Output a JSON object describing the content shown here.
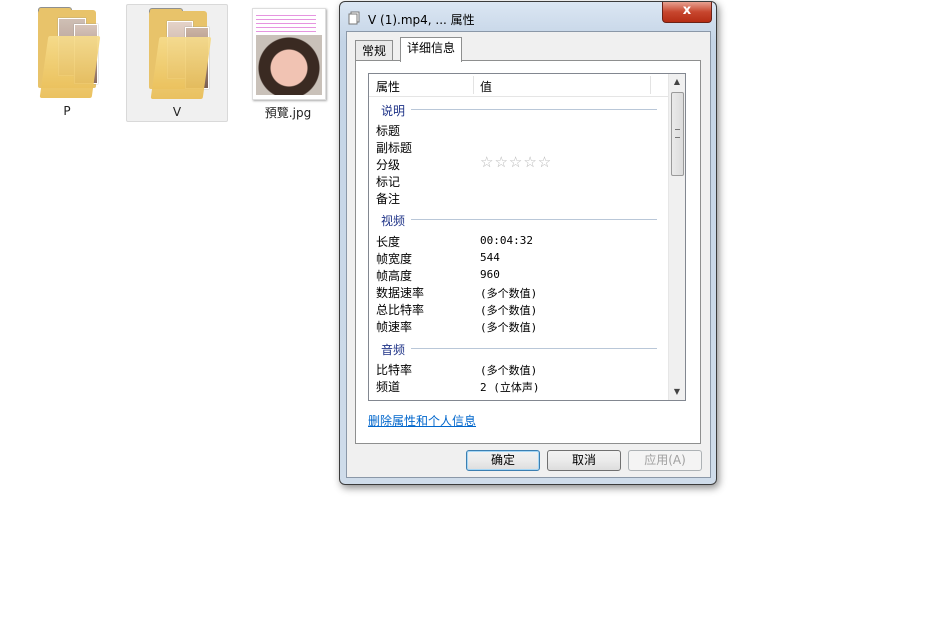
{
  "desktop": {
    "items": [
      {
        "label": "P"
      },
      {
        "label": "V"
      },
      {
        "label": "預覽.jpg"
      }
    ]
  },
  "dialog": {
    "title": "V (1).mp4, ... 属性",
    "close_label": "x",
    "tabs": [
      {
        "label": "常规"
      },
      {
        "label": "详细信息"
      }
    ],
    "active_tab": "详细信息",
    "columns": {
      "property": "属性",
      "value": "值"
    },
    "groups": {
      "description": {
        "header": "说明",
        "rows": [
          {
            "label": "标题",
            "value": ""
          },
          {
            "label": "副标题",
            "value": ""
          },
          {
            "label": "分级",
            "value": "",
            "rating_stars": 0,
            "rating_max": 5
          },
          {
            "label": "标记",
            "value": ""
          },
          {
            "label": "备注",
            "value": ""
          }
        ]
      },
      "video": {
        "header": "视频",
        "rows": [
          {
            "label": "长度",
            "value": "00:04:32"
          },
          {
            "label": "帧宽度",
            "value": "544"
          },
          {
            "label": "帧高度",
            "value": "960"
          },
          {
            "label": "数据速率",
            "value": "(多个数值)"
          },
          {
            "label": "总比特率",
            "value": "(多个数值)"
          },
          {
            "label": "帧速率",
            "value": "(多个数值)"
          }
        ]
      },
      "audio": {
        "header": "音频",
        "rows": [
          {
            "label": "比特率",
            "value": "(多个数值)"
          },
          {
            "label": "频道",
            "value": "2 (立体声)"
          }
        ]
      }
    },
    "remove_link": "删除属性和个人信息",
    "buttons": {
      "ok": "确定",
      "cancel": "取消",
      "apply": "应用(A)"
    },
    "rating_glyphs": "☆☆☆☆☆",
    "scroll_up_glyph": "▲",
    "scroll_down_glyph": "▼"
  }
}
